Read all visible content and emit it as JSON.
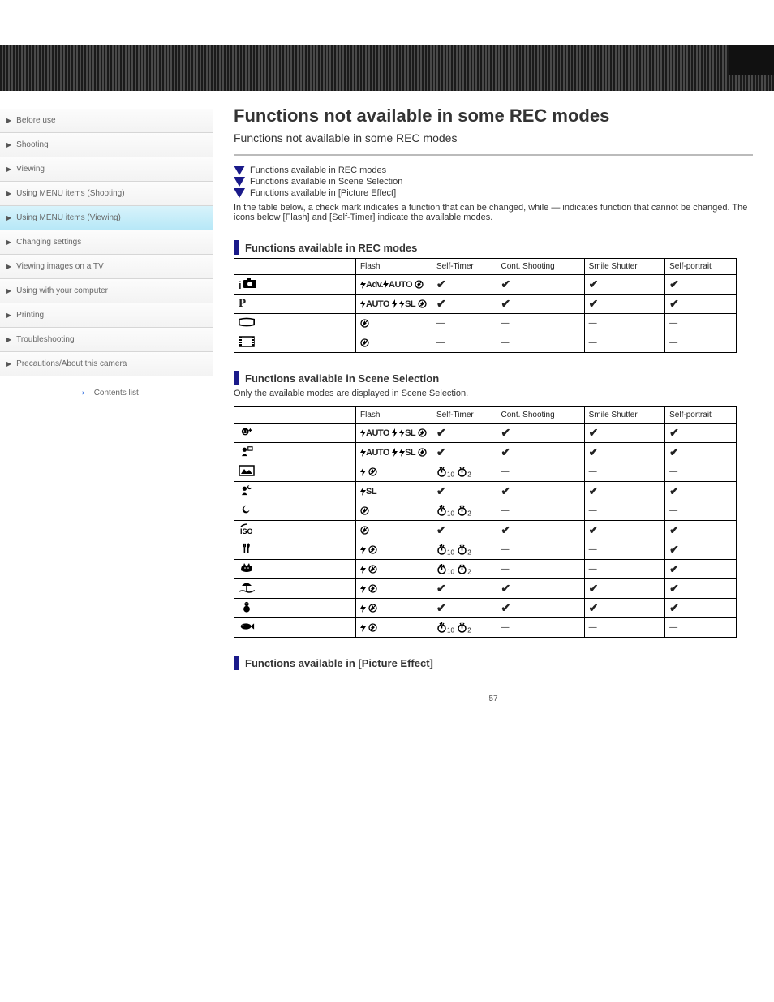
{
  "header": {},
  "sidebar": {
    "items": [
      {
        "label": "Before use"
      },
      {
        "label": "Shooting"
      },
      {
        "label": "Viewing"
      },
      {
        "label": "Using MENU items (Shooting)"
      },
      {
        "label": "Using MENU items (Viewing)"
      },
      {
        "label": "Changing settings"
      },
      {
        "label": "Viewing images on a TV"
      },
      {
        "label": "Using with your computer"
      },
      {
        "label": "Printing"
      },
      {
        "label": "Troubleshooting"
      },
      {
        "label": "Precautions/About this camera"
      }
    ],
    "contents_label": "Contents list"
  },
  "content": {
    "title": "Functions not available in some REC modes",
    "subtitle": "Functions not available in some REC modes",
    "links": [
      "Functions available in REC modes",
      "Functions available in Scene Selection",
      "Functions available in [Picture Effect]"
    ],
    "note_after_links": "In the table below, a check mark indicates a function that can be changed, while — indicates function that cannot be changed. The icons below [Flash] and [Self-Timer] indicate the available modes.",
    "sections": [
      {
        "title": "Functions available in REC modes",
        "headers": [
          "",
          "Flash",
          "Self-Timer",
          "Cont. Shooting",
          "Smile Shutter",
          "Self-portrait"
        ],
        "rows": [
          {
            "mode": "intelligent-auto",
            "mode_label": "i📷",
            "flash": "adv-auto-off",
            "st": "check",
            "cs": "check",
            "ss": "check",
            "sp": "check"
          },
          {
            "mode": "program",
            "mode_label": "P",
            "flash": "auto-on-sl-off",
            "st": "check",
            "cs": "check",
            "ss": "check",
            "sp": "check"
          },
          {
            "mode": "panorama",
            "mode_label": "▭",
            "flash": "off-only",
            "st": "—",
            "cs": "—",
            "ss": "—",
            "sp": "—"
          },
          {
            "mode": "movie",
            "mode_label": "🎞",
            "flash": "off-only",
            "st": "—",
            "cs": "—",
            "ss": "—",
            "sp": "—"
          }
        ]
      },
      {
        "title": "Functions available in Scene Selection",
        "note": "Only the available modes are displayed in Scene Selection.",
        "headers": [
          "",
          "Flash",
          "Self-Timer",
          "Cont. Shooting",
          "Smile Shutter",
          "Self-portrait"
        ],
        "rows": [
          {
            "mode": "soft-skin",
            "flash": "auto-on-sl-off",
            "st": "check",
            "cs": "check",
            "ss": "check",
            "sp": "check"
          },
          {
            "mode": "soft-snap",
            "flash": "auto-on-sl-off",
            "st": "check",
            "cs": "check",
            "ss": "check",
            "sp": "check"
          },
          {
            "mode": "landscape",
            "flash": "on-off",
            "st": "timer",
            "cs": "—",
            "ss": "—",
            "sp": "—"
          },
          {
            "mode": "night-portrait",
            "flash": "sl",
            "st": "check",
            "cs": "check",
            "ss": "check",
            "sp": "check"
          },
          {
            "mode": "night",
            "flash": "off-only",
            "st": "timer",
            "cs": "—",
            "ss": "—",
            "sp": "—"
          },
          {
            "mode": "high-sensitivity",
            "flash": "off-only",
            "st": "check",
            "cs": "check",
            "ss": "check",
            "sp": "check"
          },
          {
            "mode": "gourmet",
            "flash": "on-off",
            "st": "timer",
            "cs": "—",
            "ss": "—",
            "sp": "check"
          },
          {
            "mode": "pet",
            "flash": "on-off",
            "st": "timer",
            "cs": "—",
            "ss": "—",
            "sp": "check"
          },
          {
            "mode": "beach",
            "flash": "on-off",
            "st": "check",
            "cs": "check",
            "ss": "check",
            "sp": "check"
          },
          {
            "mode": "snow",
            "flash": "on-off",
            "st": "check",
            "cs": "check",
            "ss": "check",
            "sp": "check"
          },
          {
            "mode": "underwater",
            "flash": "on-off",
            "st": "timer",
            "cs": "—",
            "ss": "—",
            "sp": "—"
          }
        ]
      },
      {
        "title": "Functions available in [Picture Effect]"
      }
    ]
  },
  "page_number": "57",
  "flash_label_map": {
    "adv-auto-off": "⚡Adv.⚡AUTO ⊘",
    "auto-on-sl-off": "⚡AUTO ⚡ ⚡SL ⊘",
    "on-off": "⚡ ⊘",
    "sl": "⚡SL",
    "off-only": "⊘"
  },
  "icons": {
    "intelligent-auto": "i📷",
    "program": "P",
    "panorama": "pano",
    "movie": "film",
    "soft-skin": "face-sparkle",
    "soft-snap": "person-rect",
    "landscape": "mountain",
    "night-portrait": "person-moon",
    "night": "moon",
    "high-sensitivity": "iso",
    "gourmet": "fork-knife",
    "pet": "cat",
    "beach": "beach",
    "snow": "snowman",
    "underwater": "fish"
  }
}
